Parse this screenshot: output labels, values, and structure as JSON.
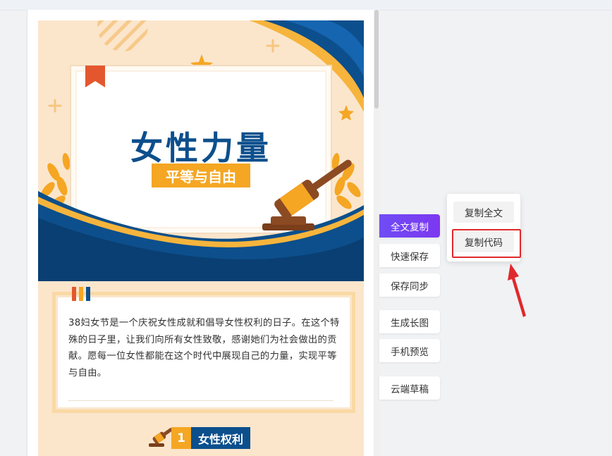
{
  "banner": {
    "title": "女性力量",
    "subtitle": "平等与自由"
  },
  "intro_text": "38妇女节是一个庆祝女性成就和倡导女性权利的日子。在这个特殊的日子里，让我们向所有女性致敬，感谢她们为社会做出的贡献。愿每一位女性都能在这个时代中展现自己的力量，实现平等与自由。",
  "section": {
    "number": "1",
    "title": "女性权利"
  },
  "sidebar": {
    "buttons": [
      {
        "label": "全文复制",
        "active": true
      },
      {
        "label": "快速保存"
      },
      {
        "label": "保存同步"
      },
      {
        "label": "生成长图"
      },
      {
        "label": "手机预览"
      },
      {
        "label": "云端草稿"
      }
    ]
  },
  "copy_menu": {
    "items": [
      {
        "label": "复制全文"
      },
      {
        "label": "复制代码"
      }
    ]
  },
  "colors": {
    "accent_purple": "#7040f2",
    "brand_blue": "#0c4f8c",
    "brand_orange": "#f5a623",
    "highlight_red": "#e0292b"
  }
}
